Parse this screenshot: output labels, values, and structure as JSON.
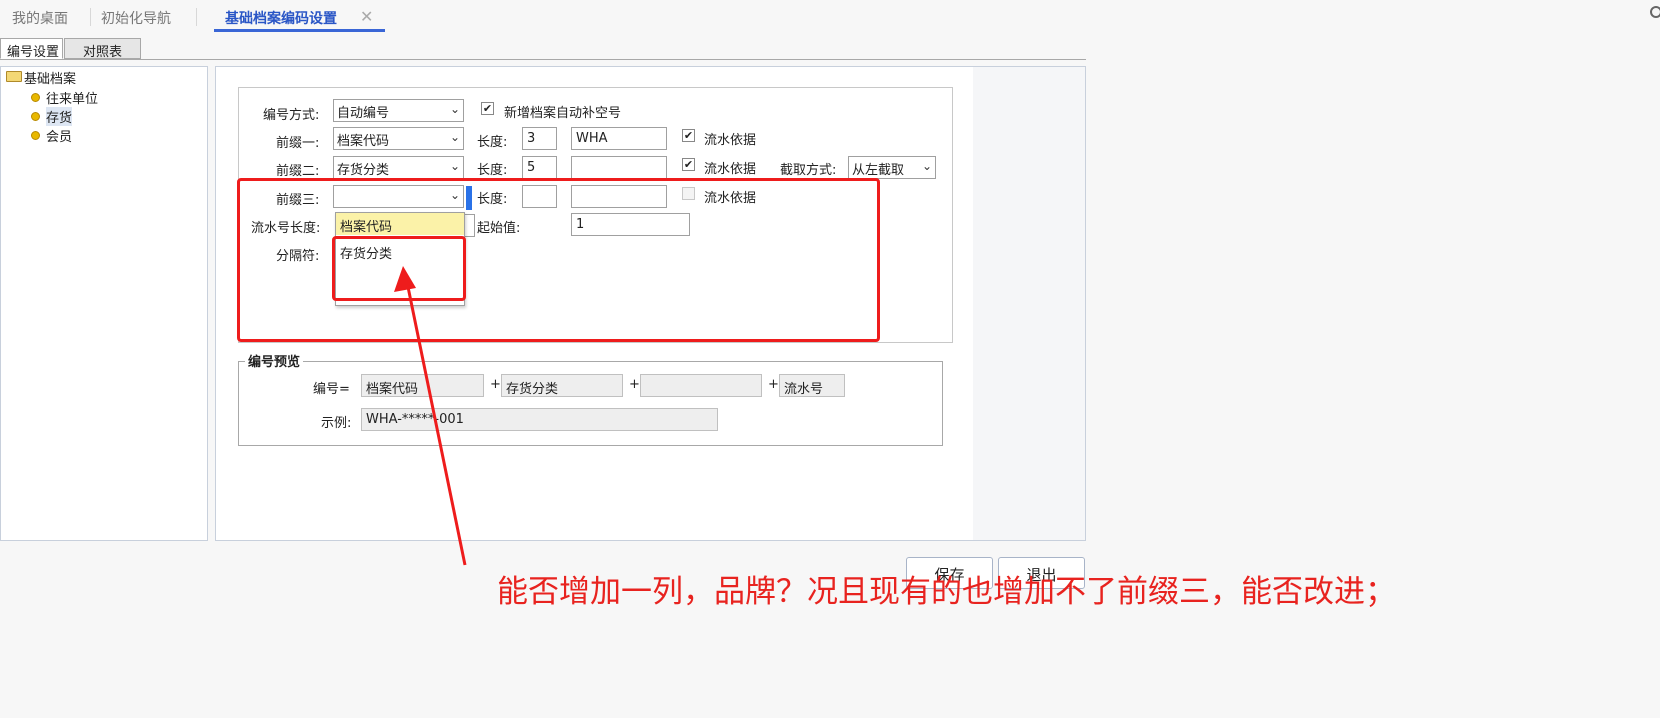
{
  "top_tabs": {
    "desk": "我的桌面",
    "init_nav": "初始化导航",
    "active": "基础档案编码设置",
    "close": "✕"
  },
  "sub_tabs": {
    "numbering": "编号设置",
    "mapping": "对照表"
  },
  "tree": {
    "root": "基础档案",
    "children": [
      "往来单位",
      "存货",
      "会员"
    ]
  },
  "form": {
    "mode_label": "编号方式:",
    "mode_value": "自动编号",
    "auto_fill_label": "新增档案自动补空号",
    "prefix1_label": "前缀一:",
    "prefix1_value": "档案代码",
    "prefix2_label": "前缀二:",
    "prefix2_value": "存货分类",
    "prefix3_label": "前缀三:",
    "prefix3_value": "",
    "length_label": "长度:",
    "len1": "3",
    "len2": "5",
    "len3": "",
    "text1": "WHA",
    "text2": "",
    "text3": "",
    "flow_basis_label": "流水依据",
    "cut_mode_label": "截取方式:",
    "cut_mode_value": "从左截取",
    "serial_len_label": "流水号长度:",
    "start_label": "起始值:",
    "start_value": "1",
    "separator_label": "分隔符:"
  },
  "dropdown": {
    "options": [
      "档案代码",
      "存货分类"
    ]
  },
  "preview": {
    "title": "编号预览",
    "code_label": "编号=",
    "parts": [
      "档案代码",
      "存货分类",
      "",
      "流水号"
    ],
    "plus": "+",
    "example_label": "示例:",
    "example_value": "WHA-*****-001"
  },
  "buttons": {
    "save": "保存",
    "exit": "退出"
  },
  "annotation": {
    "text": "能否增加一列，品牌？况且现有的也增加不了前缀三，能否改进；",
    "color": "#e8231f"
  }
}
